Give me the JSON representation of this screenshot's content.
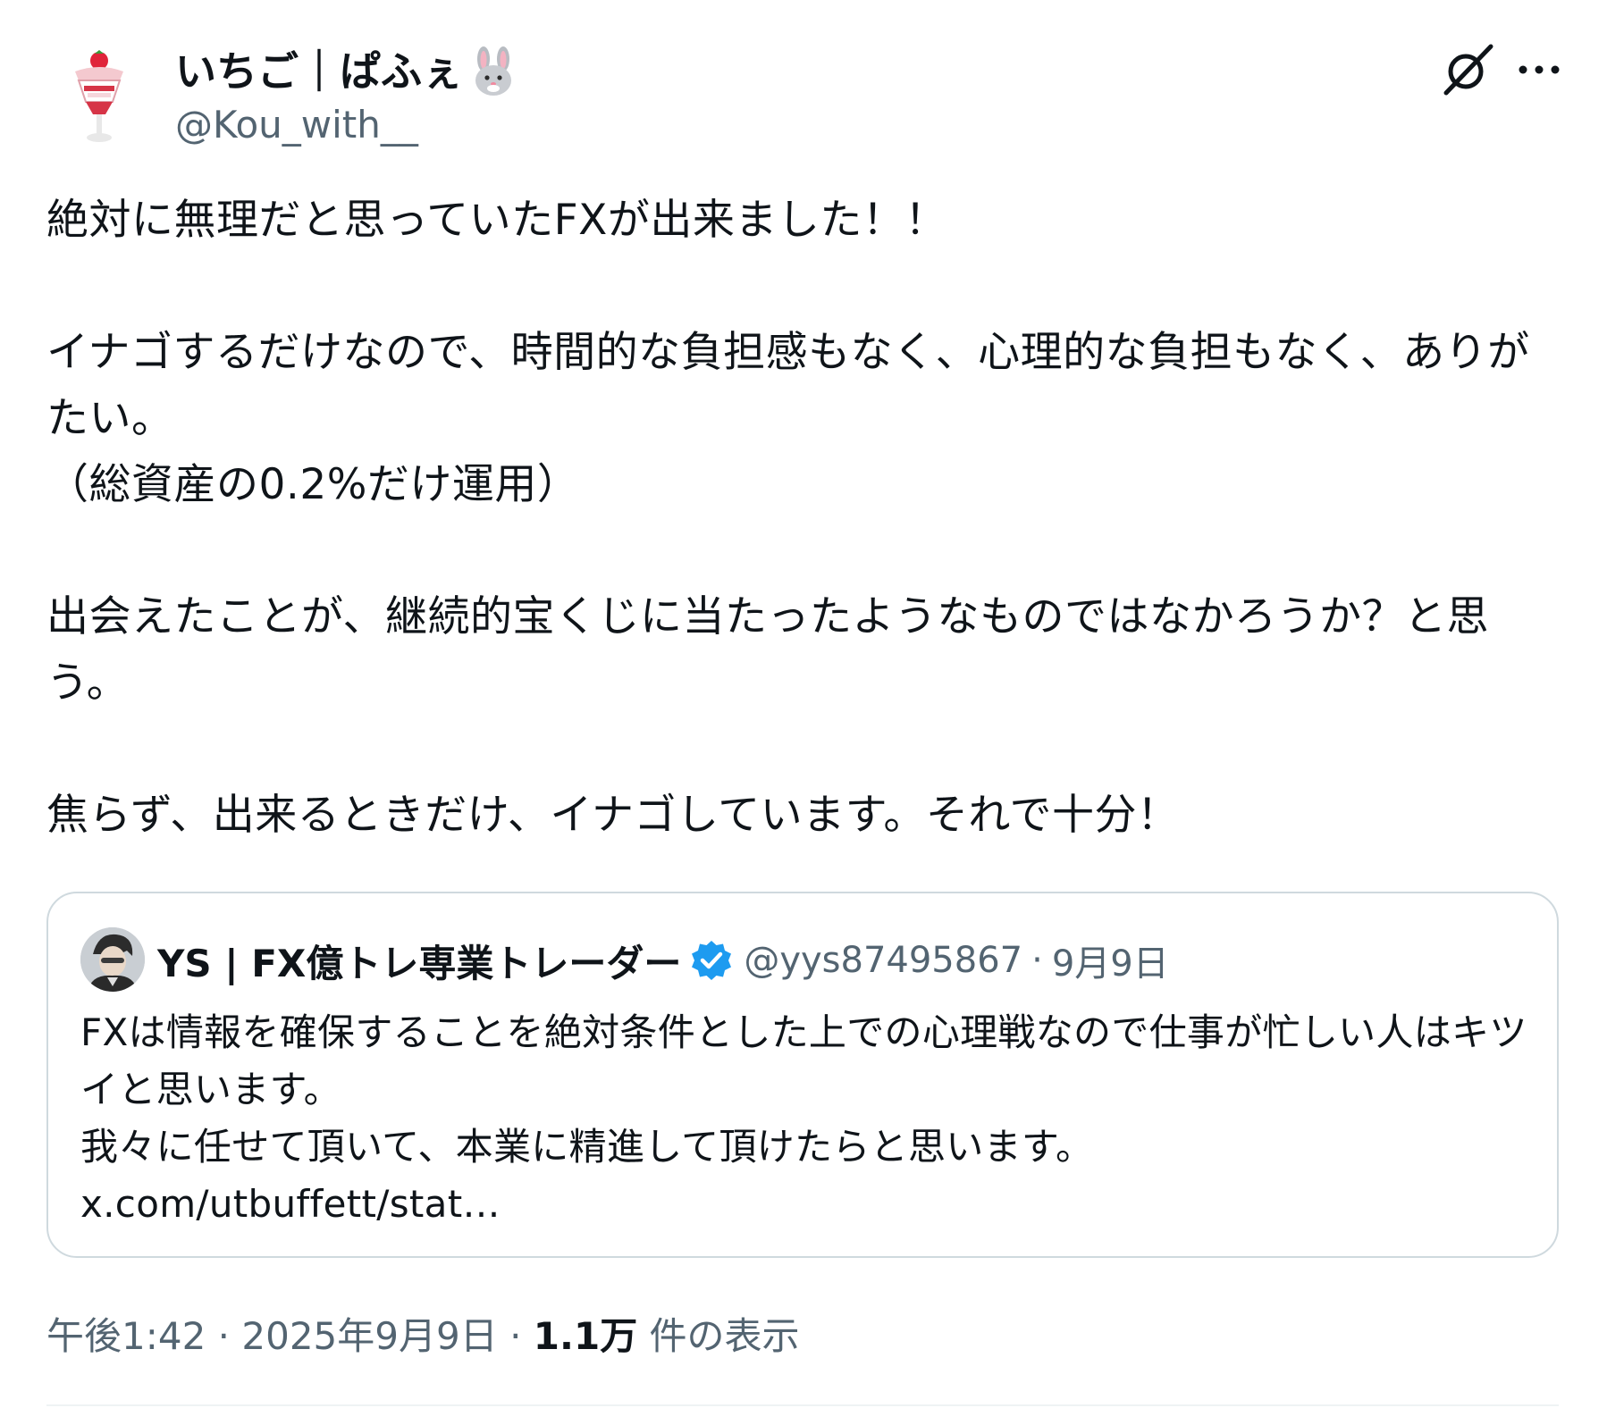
{
  "author": {
    "display_name": "いちご｜ぱふぇ",
    "name_emoji": "rabbit-face",
    "handle": "@Kou_with__",
    "avatar": "strawberry-parfait-icon"
  },
  "actions": {
    "grok_icon": "grok-icon",
    "more_icon": "more-icon"
  },
  "post": {
    "line1": "絶対に無理だと思っていたFXが出来ました！！",
    "line2": "イナゴするだけなので、時間的な負担感もなく、心理的な負担もなく、ありがたい。",
    "line3": "（総資産の0.2%だけ運用）",
    "line4": "出会えたことが、継続的宝くじに当たったようなものではなかろうか？と思う。",
    "line5": "焦らず、出来るときだけ、イナゴしています。それで十分！"
  },
  "quote": {
    "display_name": "YS | FX億トレ専業トレーダー",
    "verified_icon": "verified-badge-icon",
    "handle": "@yys87495867",
    "separator": "·",
    "date": "9月9日",
    "text1": "FXは情報を確保することを絶対条件とした上での心理戦なので仕事が忙しい人はキツイと思います。",
    "text2": "我々に任せて頂いて、本業に精進して頂けたらと思います。",
    "link": "x.com/utbuffett/stat…"
  },
  "meta": {
    "time": "午後1:42",
    "sep1": " · ",
    "date": "2025年9月9日",
    "sep2": " · ",
    "views_count": "1.1万",
    "views_label": " 件の表示"
  },
  "colors": {
    "text": "#0f1419",
    "secondary": "#536471",
    "border": "#cfd9de",
    "verified": "#1d9bf0"
  }
}
